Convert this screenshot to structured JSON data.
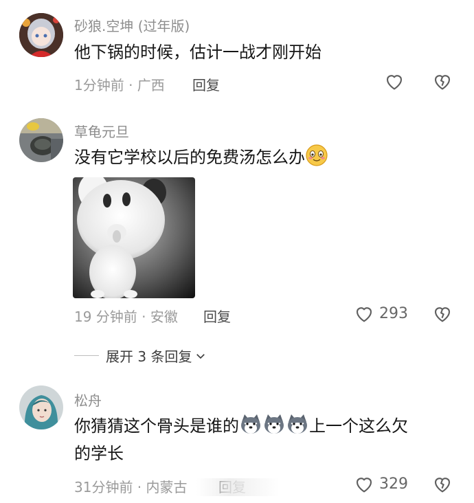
{
  "comments": [
    {
      "username": "砂狼.空坤 (过年版)",
      "text": "他下锅的时候，估计一战才刚开始",
      "time_location": "1分钟前 · 广西",
      "reply_label": "回复"
    },
    {
      "username": "草龟元旦",
      "text": "没有它学校以后的免费汤怎么办",
      "time_location": "19 分钟前 · 安徽",
      "reply_label": "回复",
      "likes": "293"
    },
    {
      "username": "松舟",
      "text_line1": "你猜猜这个骨头是谁的",
      "text_line1_tail": "上一个这么欠",
      "text_line2": "的学长",
      "time_location": "31分钟前 · 内蒙古",
      "reply_label": "回复",
      "likes": "329"
    }
  ],
  "expand_replies": {
    "label": "展开 3 条回复"
  },
  "icons": {
    "like": "heart-outline-icon",
    "dislike": "broken-heart-icon",
    "expand": "chevron-down-icon",
    "emoji_smile": "blushing-smile-emoji",
    "emoji_husky": "husky-emoji"
  },
  "colors": {
    "text": "#161616",
    "muted": "#9a9a9a",
    "icon": "#5f5f5f"
  }
}
